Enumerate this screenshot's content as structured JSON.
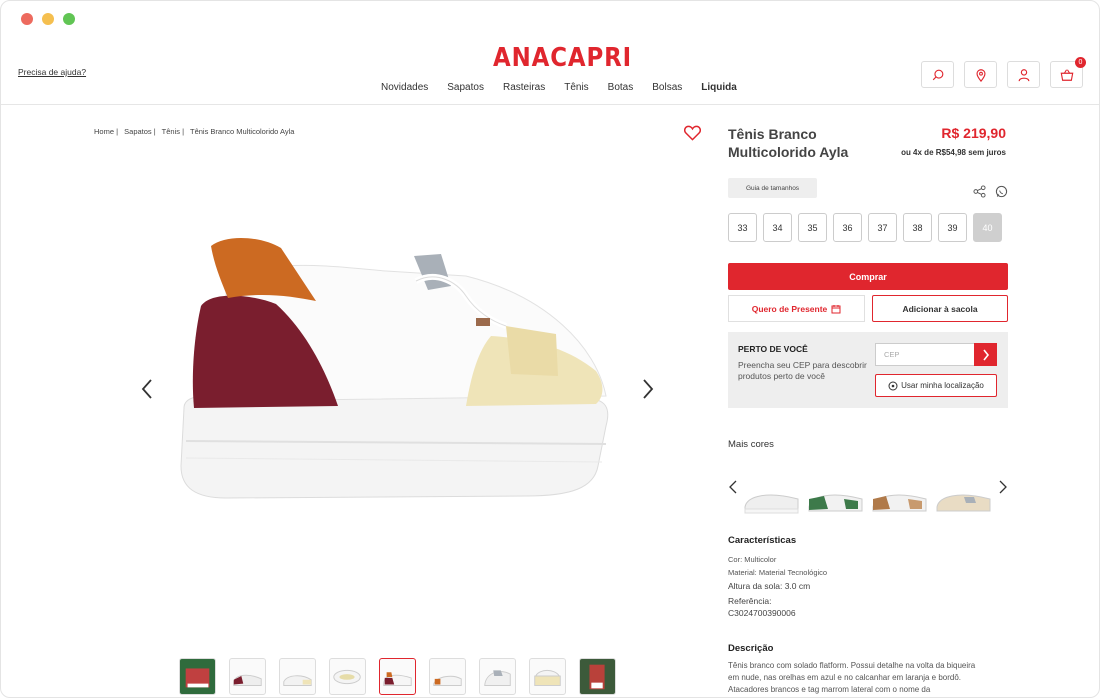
{
  "header": {
    "help_link": "Precisa de ajuda?",
    "logo": "ANACAPRI",
    "nav": [
      "Novidades",
      "Sapatos",
      "Rasteiras",
      "Tênis",
      "Botas",
      "Bolsas",
      "Liquida"
    ],
    "cart_count": "0"
  },
  "breadcrumb": [
    "Home |",
    "Sapatos |",
    "Tênis |",
    "Tênis Branco Multicolorido Ayla"
  ],
  "product": {
    "title": "Tênis Branco Multicolorido Ayla",
    "price": "R$ 219,90",
    "installments": "ou 4x de R$54,98 sem juros",
    "size_guide": "Guia de tamanhos",
    "sizes": [
      "33",
      "34",
      "35",
      "36",
      "37",
      "38",
      "39",
      "40"
    ],
    "unavailable_size": "40",
    "buy_label": "Comprar",
    "gift_label": "Quero de Presente",
    "bag_label": "Adicionar à sacola"
  },
  "near_you": {
    "title": "PERTO DE VOCÊ",
    "description": "Preencha seu CEP para descobrir produtos perto de você",
    "cep_placeholder": "CEP",
    "location_label": "Usar minha localização"
  },
  "more_colors": {
    "title": "Mais cores"
  },
  "characteristics": {
    "title": "Características",
    "color": "Cor: Multicolor",
    "material": "Material: Material Tecnológico",
    "sole_height": "Altura da sola: 3.0 cm",
    "reference_label": "Referência:",
    "reference_value": "C3024700390006"
  },
  "description": {
    "title": "Descrição",
    "text": "Tênis branco com solado flatform. Possui detalhe na volta da biqueira em nude, nas orelhas em azul e no calcanhar em laranja e bordô. Atacadores brancos e tag marrom lateral com o nome da"
  },
  "colors": {
    "brand": "#e0262e"
  }
}
